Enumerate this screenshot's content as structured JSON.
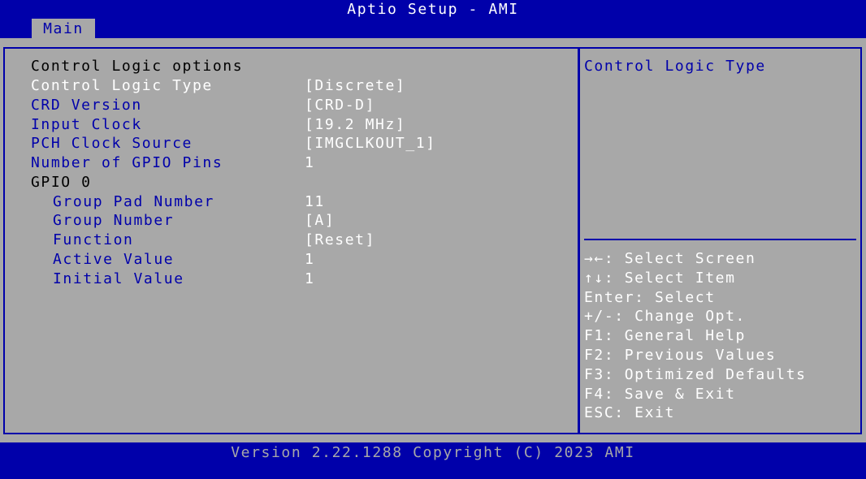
{
  "window_title": "Aptio Setup - AMI",
  "tabs": [
    {
      "label": "Main"
    }
  ],
  "section_header": "Control Logic options",
  "items": [
    {
      "label": "Control Logic Type",
      "value": "[Discrete]"
    },
    {
      "label": "CRD Version",
      "value": "[CRD-D]"
    },
    {
      "label": "Input Clock",
      "value": "[19.2 MHz]"
    },
    {
      "label": "PCH Clock Source",
      "value": "[IMGCLKOUT_1]"
    },
    {
      "label": "Number of GPIO Pins",
      "value": "1"
    }
  ],
  "gpio_header": "GPIO 0",
  "gpio_items": [
    {
      "label": "Group Pad Number",
      "value": "11"
    },
    {
      "label": "Group Number",
      "value": "[A]"
    },
    {
      "label": "Function",
      "value": "[Reset]"
    },
    {
      "label": "Active Value",
      "value": "1"
    },
    {
      "label": "Initial Value",
      "value": "1"
    }
  ],
  "help": {
    "title": "Control Logic Type",
    "keys": [
      "→←: Select Screen",
      "↑↓: Select Item",
      "Enter: Select",
      "+/-: Change Opt.",
      "F1: General Help",
      "F2: Previous Values",
      "F3: Optimized Defaults",
      "F4: Save & Exit",
      "ESC: Exit"
    ]
  },
  "footer": "Version 2.22.1288 Copyright (C) 2023 AMI",
  "colors": {
    "background": "#0000aa",
    "panel": "#a8a8a8",
    "label": "#0000aa",
    "value": "#ffffff"
  }
}
